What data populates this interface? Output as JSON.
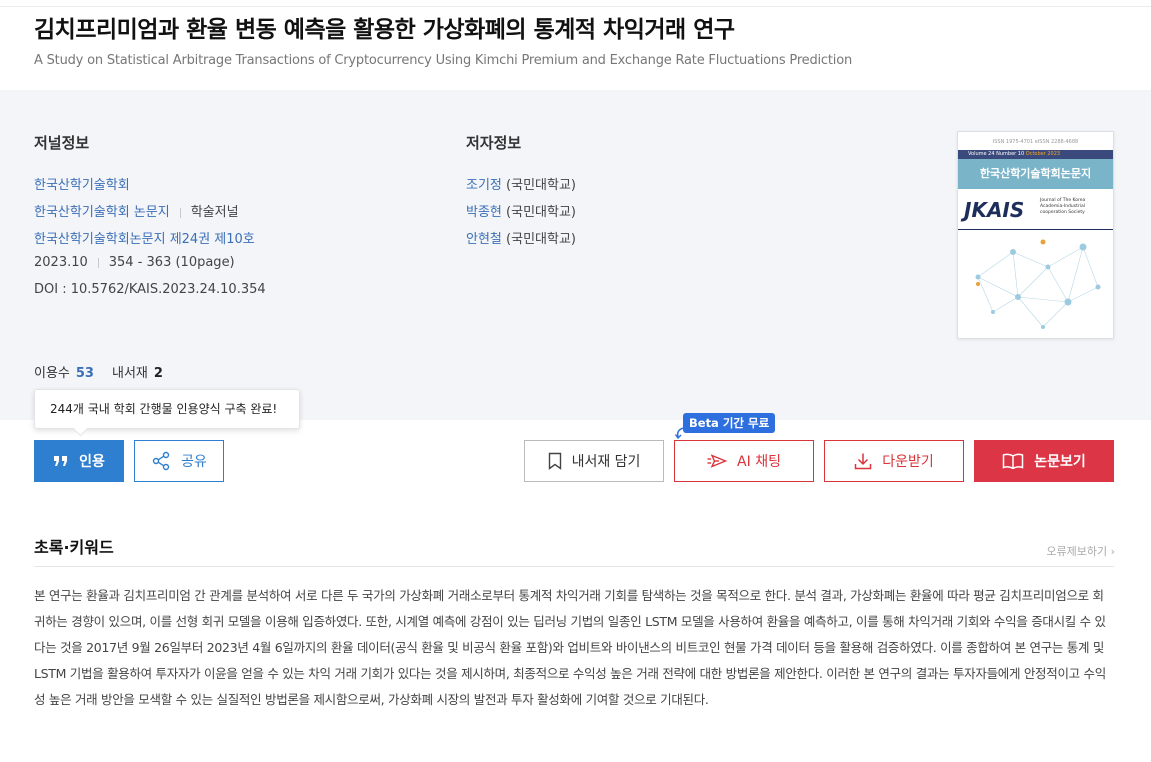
{
  "paper": {
    "title": "김치프리미엄과 환율 변동 예측을 활용한 가상화폐의 통계적 차익거래 연구",
    "subtitle": "A Study on Statistical Arbitrage Transactions of Cryptocurrency Using Kimchi Premium and Exchange Rate Fluctuations Prediction"
  },
  "journal_info": {
    "heading": "저널정보",
    "publisher": "한국산학기술학회",
    "journal": "한국산학기술학회 논문지",
    "type": "학술저널",
    "issue": "한국산학기술학회논문지 제24권 제10호",
    "date": "2023.10",
    "pages": "354 - 363 (10page)",
    "doi": "DOI : 10.5762/KAIS.2023.24.10.354"
  },
  "author_info": {
    "heading": "저자정보",
    "authors": [
      {
        "name": "조기정",
        "affiliation": "(국민대학교)"
      },
      {
        "name": "박종현",
        "affiliation": "(국민대학교)"
      },
      {
        "name": "안현철",
        "affiliation": "(국민대학교)"
      }
    ]
  },
  "cover": {
    "issn": "ISSN 1975-4701   eISSN 2288-4688",
    "volume": "Volume 24 Number 10",
    "month": "October 2023",
    "journal_name": "한국산학기술학회논문지",
    "logo": "JKAIS",
    "logo_sub": "Journal of The Korea Academia-Industrial cooperation Society",
    "publisher": "한국산학기술학회"
  },
  "stats": {
    "usage_label": "이용수",
    "usage_count": "53",
    "library_label": "내서재",
    "library_count": "2"
  },
  "tooltip": "244개 국내 학회 간행물 인용양식 구축 완료!",
  "beta_badge": "Beta 기간 무료",
  "buttons": {
    "cite": "인용",
    "share": "공유",
    "save": "내서재 담기",
    "ai_chat": "AI 채팅",
    "download": "다운받기",
    "view": "논문보기"
  },
  "abstract_section": {
    "heading": "초록·키워드",
    "report": "오류제보하기 ›",
    "text": "본 연구는 환율과 김치프리미엄 간 관계를 분석하여 서로 다른 두 국가의 가상화폐 거래소로부터 통계적 차익거래 기회를 탐색하는 것을 목적으로 한다. 분석 결과, 가상화폐는 환율에 따라 평균 김치프리미엄으로 회귀하는 경향이 있으며, 이를 선형 회귀 모델을 이용해 입증하였다. 또한, 시계열 예측에 강점이 있는 딥러닝 기법의 일종인 LSTM 모델을 사용하여 환율을 예측하고, 이를 통해 차익거래 기회와 수익을 증대시킬 수 있다는 것을 2017년 9월 26일부터 2023년 4월 6일까지의 환율 데이터(공식 환율 및 비공식 환율 포함)와 업비트와 바이낸스의 비트코인 현물 가격 데이터 등을 활용해 검증하였다. 이를 종합하여 본 연구는 통계 및 LSTM 기법을 활용하여 투자자가 이윤을 얻을 수 있는 차익 거래 기회가 있다는 것을 제시하며, 최종적으로 수익성 높은 거래 전략에 대한 방법론을 제안한다. 이러한 본 연구의 결과는 투자자들에게 안정적이고 수익성 높은 거래 방안을 모색할 수 있는 실질적인 방법론을 제시함으로써, 가상화폐 시장의 발전과 투자 활성화에 기여할 것으로 기대된다."
  },
  "colors": {
    "link": "#3b6fb6",
    "primary_blue": "#2e7fd0",
    "accent_red": "#dc3545",
    "info_bg": "#f3f5f9"
  }
}
